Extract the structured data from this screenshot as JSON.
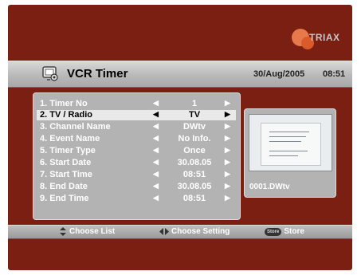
{
  "brand": {
    "name": "TRIAX"
  },
  "header": {
    "title": "VCR Timer",
    "date": "30/Aug/2005",
    "time": "08:51",
    "icon": "tv-settings-icon"
  },
  "menu": {
    "items": [
      {
        "label": "1. Timer No",
        "value": "1"
      },
      {
        "label": "2. TV / Radio",
        "value": "TV",
        "selected": true
      },
      {
        "label": "3. Channel Name",
        "value": "DWtv"
      },
      {
        "label": "4. Event Name",
        "value": "No Info."
      },
      {
        "label": "5. Timer Type",
        "value": "Once"
      },
      {
        "label": "6. Start Date",
        "value": "30.08.05"
      },
      {
        "label": "7. Start Time",
        "value": "08:51"
      },
      {
        "label": "8. End Date",
        "value": "30.08.05"
      },
      {
        "label": "9. End Time",
        "value": "08:51"
      }
    ],
    "arrow_left": "◀",
    "arrow_right": "▶"
  },
  "preview": {
    "channel": "0001.DWtv"
  },
  "help": {
    "choose_list": "Choose List",
    "choose_setting": "Choose Setting",
    "store_key": "Store",
    "store": "Store"
  },
  "colors": {
    "background": "#7a1f12",
    "panel": "#b3b3b3",
    "highlight": "#e9e9e9",
    "logo_accent": "#e8794a"
  }
}
